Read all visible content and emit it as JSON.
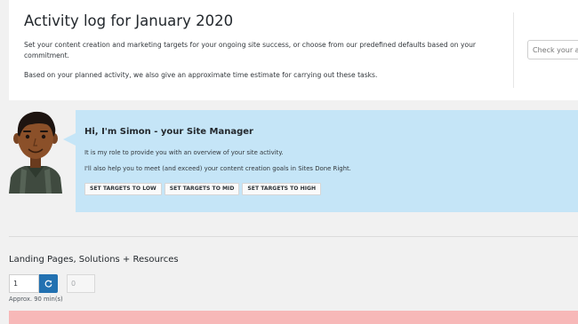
{
  "header": {
    "title": "Activity log for January 2020",
    "description": "Set your content creation and marketing targets for your ongoing site success, or choose from our predefined defaults based on your commitment.",
    "estimate_note": "Based on your planned activity, we also give an approximate time estimate for carrying out these tasks.",
    "check_placeholder": "Check your activity"
  },
  "manager": {
    "avatar_icon": "site-manager-avatar",
    "heading": "Hi, I'm Simon - your Site Manager",
    "intro": "It is my role to provide you with an overview of your site activity.",
    "help": "I'll also help you to meet (and exceed) your content creation goals in Sites Done Right.",
    "buttons": {
      "low": "SET TARGETS TO LOW",
      "mid": "SET TARGETS TO MID",
      "high": "SET TARGETS TO HIGH"
    }
  },
  "section": {
    "title": "Landing Pages, Solutions + Resources",
    "target_value": "1",
    "refresh_icon": "refresh-icon",
    "completed_value": "0",
    "estimate": "Approx. 90 min(s)"
  },
  "colors": {
    "bubble": "#c5e5f7",
    "accent": "#2271b1",
    "alert": "#f7b8b8"
  }
}
